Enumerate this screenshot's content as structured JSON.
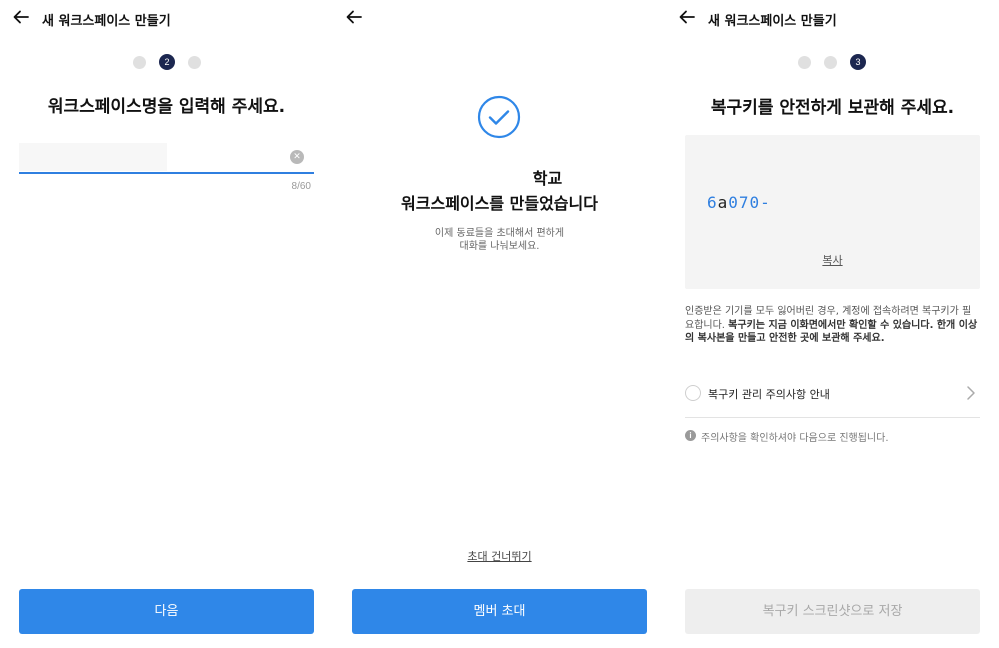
{
  "panel1": {
    "title": "새 워크스페이스 만들기",
    "current_step": "2",
    "heading": "워크스페이스명을 입력해 주세요.",
    "input": {
      "value": "",
      "placeholder": ""
    },
    "char_count": "8/60",
    "next_button": "다음"
  },
  "panel2": {
    "title_line1": "학교",
    "title_line2": "워크스페이스를 만들었습니다",
    "desc_line1": "이제 동료들을 초대해서 편하게",
    "desc_line2": "대화를 나눠보세요.",
    "skip_link": "초대 건너뛰기",
    "invite_button": "멤버 초대"
  },
  "panel3": {
    "title": "새 워크스페이스 만들기",
    "current_step": "3",
    "heading": "복구키를 안전하게 보관해 주세요.",
    "key_parts": [
      "6",
      "a",
      "070-"
    ],
    "copy_link": "복사",
    "notice_part1": "인증받은 기기를 모두 잃어버린 경우, 계정에 접속하려면 복구키가 필요합니다. ",
    "notice_bold": "복구키는 지금 이화면에서만 확인할 수 있습니다. 한개 이상의 복사본을 만들고 안전한 곳에 보관해 주세요.",
    "confirm_label": "복구키 관리 주의사항 안내",
    "info_text": "주의사항을 확인하셔야 다음으로 진행됩니다.",
    "save_button": "복구키 스크린샷으로 저장"
  },
  "colors": {
    "primary": "#2f87e8",
    "step_active": "#1c2750",
    "key_text": "#2f7fe0",
    "disabled_bg": "#eeeeee"
  },
  "icons": {
    "back": "arrow-left-icon",
    "clear": "clear-circle-icon",
    "success": "check-circle-icon",
    "chevron": "chevron-right-icon",
    "info": "info-icon"
  }
}
